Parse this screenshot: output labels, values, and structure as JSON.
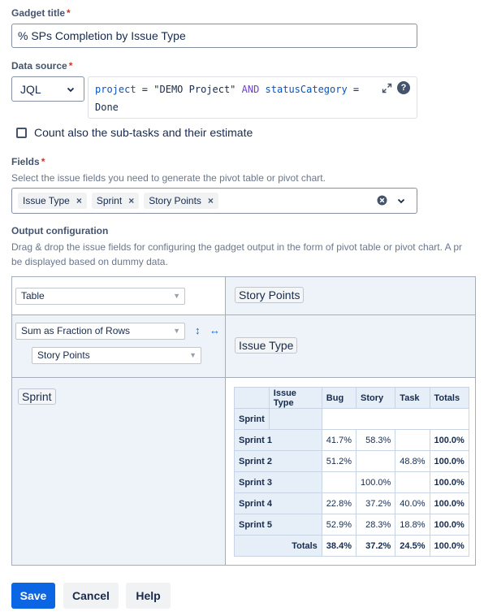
{
  "gadget_title": {
    "label": "Gadget title",
    "required_mark": "*",
    "value": "% SPs Completion by Issue Type"
  },
  "data_source": {
    "label": "Data source",
    "required_mark": "*",
    "type_value": "JQL",
    "jql_parts": {
      "field1": "project",
      "op1": " = ",
      "val1": "\"DEMO Project\"",
      "and": " AND ",
      "field2": "statusCategory",
      "op2": " =",
      "val2": "Done"
    }
  },
  "subtasks": {
    "label": "Count also the sub-tasks and their estimate",
    "checked": false
  },
  "fields": {
    "label": "Fields",
    "required_mark": "*",
    "help": "Select the issue fields you need to generate the pivot table or pivot chart.",
    "tags": [
      "Issue Type",
      "Sprint",
      "Story Points"
    ],
    "tag_remove": "×"
  },
  "output": {
    "label": "Output configuration",
    "help_line1": "Drag & drop the issue fields for configuring the gadget output in the form of pivot table or pivot chart. A pr",
    "help_line2": "be displayed based on dummy data.",
    "renderer": "Table",
    "aggregator": "Sum as Fraction of Rows",
    "aggregator_field": "Story Points",
    "col_field": "Story Points",
    "row_axis_field": "Issue Type",
    "row_field": "Sprint",
    "sort_icons": {
      "vertical": "↕",
      "horizontal": "↔"
    }
  },
  "pivot": {
    "corner_col": "Issue Type",
    "corner_row": "Sprint",
    "columns": [
      "Bug",
      "Story",
      "Task",
      "Totals"
    ],
    "rows": [
      {
        "label": "Sprint 1",
        "cells": [
          "41.7%",
          "58.3%",
          "",
          "100.0%"
        ]
      },
      {
        "label": "Sprint 2",
        "cells": [
          "51.2%",
          "",
          "48.8%",
          "100.0%"
        ]
      },
      {
        "label": "Sprint 3",
        "cells": [
          "",
          "100.0%",
          "",
          "100.0%"
        ]
      },
      {
        "label": "Sprint 4",
        "cells": [
          "22.8%",
          "37.2%",
          "40.0%",
          "100.0%"
        ]
      },
      {
        "label": "Sprint 5",
        "cells": [
          "52.9%",
          "28.3%",
          "18.8%",
          "100.0%"
        ]
      }
    ],
    "totals": {
      "label": "Totals",
      "cells": [
        "38.4%",
        "37.2%",
        "24.5%",
        "100.0%"
      ]
    }
  },
  "buttons": {
    "save": "Save",
    "cancel": "Cancel",
    "help": "Help"
  },
  "colors": {
    "primary": "#0c66e4",
    "secondary_bg": "#f1f2f4",
    "pivot_panel_bg": "#eef3f9",
    "pivot_border": "#a5adba"
  }
}
